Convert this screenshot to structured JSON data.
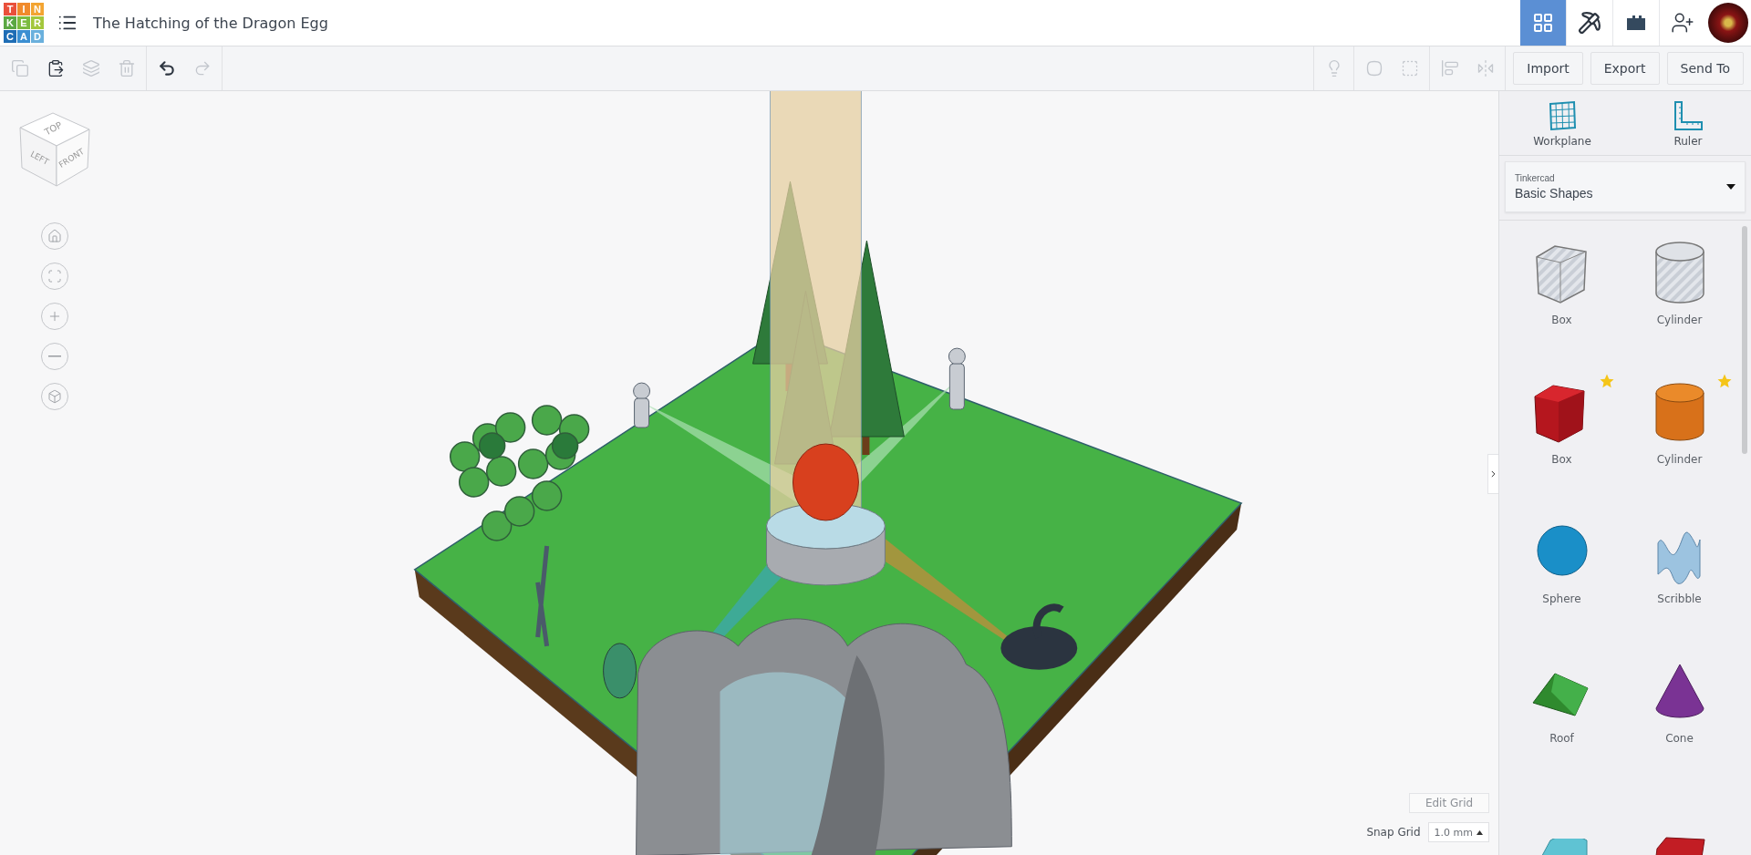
{
  "logo": {
    "letters": [
      {
        "char": "T",
        "color": "#e9503b"
      },
      {
        "char": "I",
        "color": "#f08a2c"
      },
      {
        "char": "N",
        "color": "#f3a431"
      },
      {
        "char": "K",
        "color": "#5ba843"
      },
      {
        "char": "E",
        "color": "#7cbb3f"
      },
      {
        "char": "R",
        "color": "#a3c73c"
      },
      {
        "char": "C",
        "color": "#1e6db5"
      },
      {
        "char": "A",
        "color": "#3b8fd2"
      },
      {
        "char": "D",
        "color": "#6ab0dd"
      }
    ]
  },
  "document": {
    "title": "The Hatching of the Dragon Egg"
  },
  "views": [
    {
      "kind": "grid",
      "selected": true
    },
    {
      "kind": "pickaxe",
      "selected": false
    },
    {
      "kind": "brick",
      "selected": false
    }
  ],
  "toolbar": {
    "edit_tools": [
      {
        "kind": "copy",
        "disabled": true
      },
      {
        "kind": "paste",
        "disabled": false
      },
      {
        "kind": "duplicate",
        "disabled": true
      },
      {
        "kind": "delete",
        "disabled": true
      }
    ],
    "history": [
      {
        "kind": "undo",
        "disabled": false
      },
      {
        "kind": "redo",
        "disabled": true
      }
    ],
    "shape_tools": [
      {
        "kind": "note",
        "disabled": true
      },
      {
        "kind": "group",
        "disabled": true
      },
      {
        "kind": "hole",
        "disabled": true
      },
      {
        "kind": "align",
        "disabled": true
      },
      {
        "kind": "mirror",
        "disabled": true
      }
    ],
    "buttons": [
      "Import",
      "Export",
      "Send To"
    ]
  },
  "view_cube": {
    "top": "TOP",
    "left": "LEFT",
    "front": "FRONT"
  },
  "view_controls": [
    {
      "kind": "home"
    },
    {
      "kind": "fit"
    },
    {
      "kind": "zoom-in"
    },
    {
      "kind": "zoom-out"
    },
    {
      "kind": "perspective"
    }
  ],
  "grid": {
    "edit_button": "Edit Grid",
    "snap_label": "Snap Grid",
    "snap_value": "1.0 mm"
  },
  "panel": {
    "tools": [
      {
        "kind": "workplane",
        "label": "Workplane"
      },
      {
        "kind": "ruler",
        "label": "Ruler"
      }
    ],
    "library": {
      "caption": "Tinkercad",
      "value": "Basic Shapes"
    },
    "shapes": [
      {
        "kind": "box-hole",
        "name": "Box",
        "favorite": false
      },
      {
        "kind": "cylinder-hole",
        "name": "Cylinder",
        "favorite": false
      },
      {
        "kind": "box",
        "name": "Box",
        "favorite": true
      },
      {
        "kind": "cylinder",
        "name": "Cylinder",
        "favorite": true
      },
      {
        "kind": "sphere",
        "name": "Sphere",
        "favorite": false
      },
      {
        "kind": "scribble",
        "name": "Scribble",
        "favorite": false
      },
      {
        "kind": "roof",
        "name": "Roof",
        "favorite": false
      },
      {
        "kind": "cone",
        "name": "Cone",
        "favorite": false
      },
      {
        "kind": "paraboloid",
        "favorite": false
      },
      {
        "kind": "text",
        "favorite": false
      }
    ]
  }
}
